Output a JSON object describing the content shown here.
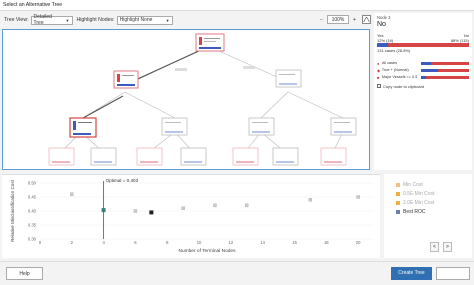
{
  "window": {
    "title": "Select an Alternative Tree"
  },
  "toolbar": {
    "tree_view_label": "Tree View:",
    "tree_view_value": "Detailed Tree",
    "highlight_label": "Highlight Nodes:",
    "highlight_value": "Highlight None",
    "zoom_minus": "−",
    "zoom_value": "100%",
    "zoom_plus": "+"
  },
  "side_panel": {
    "node_title": "Node 3",
    "node_class": "No",
    "yes_label": "Yes",
    "no_label": "No",
    "yes_pct_text": "12% (16)",
    "no_pct_text": "88% (115)",
    "yes_fraction": 0.12,
    "cases_text": "131 cases (28.8%)",
    "legend": [
      {
        "label": "All cases",
        "yes_fraction": 0.22
      },
      {
        "label": "True + (Normal)",
        "yes_fraction": 0.35
      },
      {
        "label": "Major Vessels <= 0.5",
        "yes_fraction": 0.12
      }
    ],
    "copy_label": "Copy node to clipboard"
  },
  "chart_data": {
    "type": "scatter",
    "annotation": "Optimal = 0.403",
    "optimal_x": 4,
    "xlabel": "Number of Terminal Nodes",
    "ylabel": "Relative Misclassification Cost",
    "xlim": [
      0,
      21
    ],
    "ylim": [
      0.3,
      0.5
    ],
    "x_ticks": [
      0,
      2,
      4,
      6,
      8,
      10,
      12,
      14,
      16,
      18,
      20
    ],
    "y_ticks": [
      0.3,
      0.35,
      0.4,
      0.45,
      0.5
    ],
    "points": [
      {
        "x": 2,
        "y": 0.46
      },
      {
        "x": 4,
        "y": 0.403,
        "highlight": "optimal"
      },
      {
        "x": 6,
        "y": 0.4
      },
      {
        "x": 7,
        "y": 0.395,
        "highlight": "selected"
      },
      {
        "x": 9,
        "y": 0.41
      },
      {
        "x": 11,
        "y": 0.42
      },
      {
        "x": 13,
        "y": 0.42
      },
      {
        "x": 17,
        "y": 0.44
      },
      {
        "x": 20,
        "y": 0.45
      }
    ]
  },
  "legend_panel": {
    "items": [
      {
        "label": "Min Cost",
        "color": "#f0c080",
        "faded": true
      },
      {
        "label": "0.5E Min Cost",
        "color": "#f0b040",
        "faded": true
      },
      {
        "label": "2.0E Min Cost",
        "color": "#f0b040",
        "faded": true
      },
      {
        "label": "Best ROC",
        "color": "#6a7fa8",
        "faded": false
      }
    ],
    "prev": "<",
    "next": ">"
  },
  "footer": {
    "help_label": "Help",
    "create_label": "Create Tree"
  },
  "colors": {
    "accent": "#2f6fb2",
    "yes": "#d64545",
    "no": "#3b5bbf",
    "highlight_node": "#e0727a",
    "optimal": "#3a7f78"
  }
}
